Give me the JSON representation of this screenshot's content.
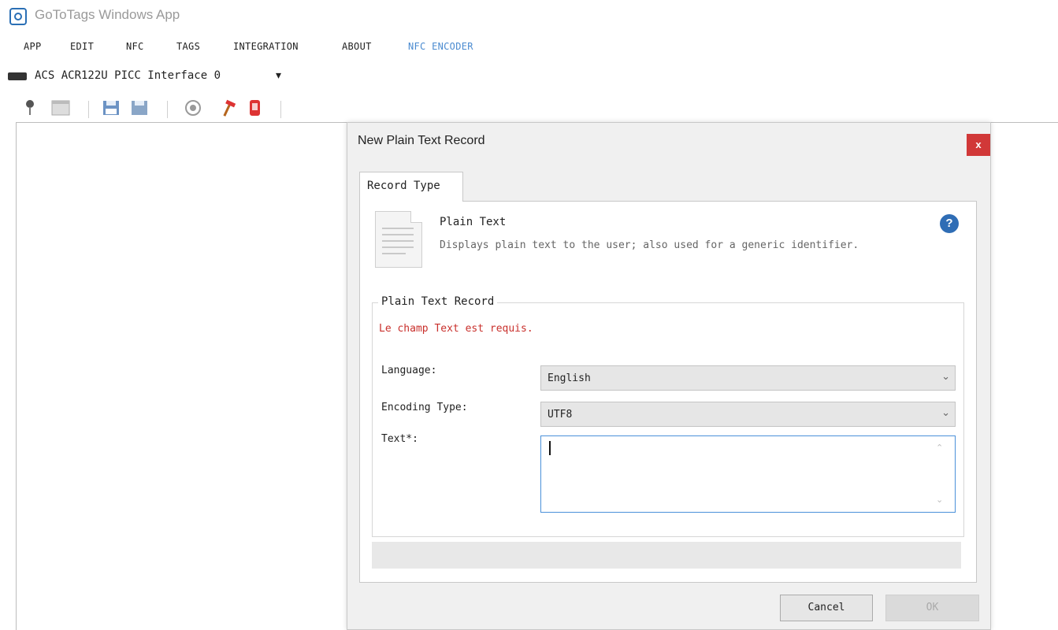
{
  "window": {
    "title": "GoToTags Windows App"
  },
  "menu": {
    "items": [
      "APP",
      "EDIT",
      "NFC",
      "TAGS",
      "INTEGRATION",
      "ABOUT"
    ],
    "active_item": "NFC ENCODER"
  },
  "device": {
    "label": "ACS ACR122U PICC Interface 0",
    "dropdown_glyph": "▾"
  },
  "toolbar": {
    "icons": [
      "location-icon",
      "window-icon",
      "save-icon",
      "save-disk-icon",
      "target-icon",
      "hammer-icon",
      "phone-icon"
    ]
  },
  "dialog": {
    "title": "New Plain Text Record",
    "close_glyph": "x",
    "tab_label": "Record Type",
    "record_type": {
      "title": "Plain Text",
      "description": "Displays plain text to the user; also used for a generic identifier.",
      "help_glyph": "?"
    },
    "group": {
      "legend": "Plain Text Record",
      "error": "Le champ Text est requis.",
      "language_label": "Language:",
      "language_value": "English",
      "encoding_label": "Encoding Type:",
      "encoding_value": "UTF8",
      "text_label": "Text*:",
      "text_value": ""
    },
    "buttons": {
      "cancel": "Cancel",
      "ok": "OK"
    }
  },
  "colors": {
    "accent": "#4b8bd0",
    "error": "#c9302c",
    "close_bg": "#d13838",
    "help_bg": "#2f6db5"
  }
}
